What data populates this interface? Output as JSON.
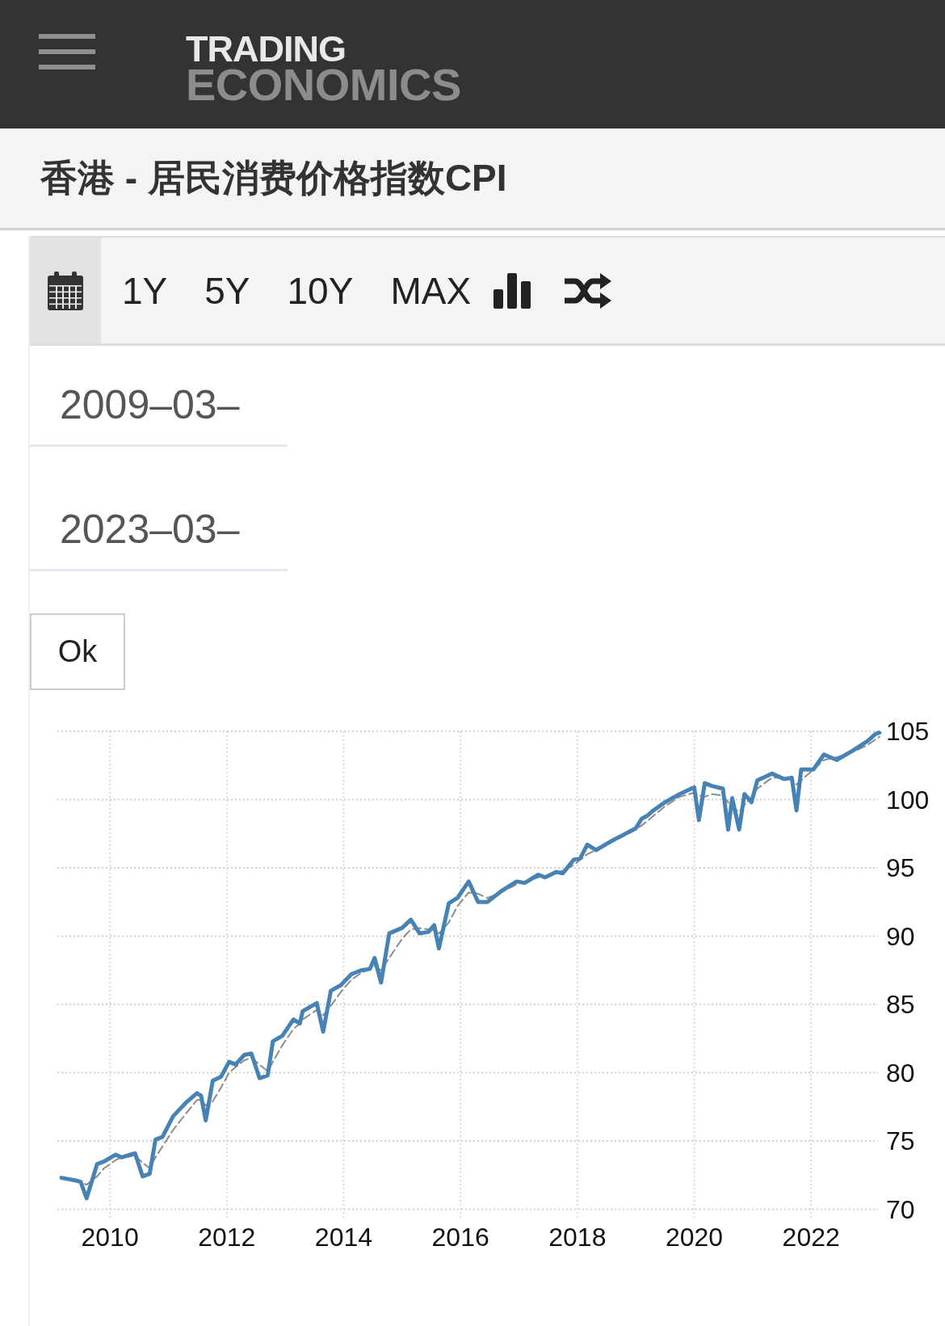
{
  "header": {
    "logo": {
      "line_1": "TRADING",
      "line_2": "ECONOMICS"
    }
  },
  "title": "香港 - 居民消费价格指数CPI",
  "toolbar": {
    "calendar_selected": true,
    "ranges": [
      {
        "label": "1Y",
        "selected": false
      },
      {
        "label": "5Y",
        "selected": false
      },
      {
        "label": "10Y",
        "selected": false
      },
      {
        "label": "MAX",
        "selected": false
      }
    ]
  },
  "date_range": {
    "from": {
      "value": "2009–03–"
    },
    "to": {
      "value": "2023–03–"
    },
    "ok_button": "Ok"
  },
  "chart": {
    "chart_data": {
      "type": "line",
      "grid": true,
      "x": [
        2009.17,
        2009.42,
        2009.5,
        2009.6,
        2009.78,
        2009.9,
        2010.1,
        2010.2,
        2010.43,
        2010.56,
        2010.68,
        2010.78,
        2010.9,
        2011.08,
        2011.3,
        2011.49,
        2011.56,
        2011.64,
        2011.76,
        2011.9,
        2012.04,
        2012.15,
        2012.3,
        2012.42,
        2012.56,
        2012.7,
        2012.79,
        2012.95,
        2013.14,
        2013.25,
        2013.3,
        2013.54,
        2013.65,
        2013.78,
        2013.95,
        2014.13,
        2014.3,
        2014.45,
        2014.53,
        2014.64,
        2014.78,
        2015.0,
        2015.15,
        2015.3,
        2015.45,
        2015.55,
        2015.63,
        2015.8,
        2015.95,
        2016.14,
        2016.3,
        2016.46,
        2016.7,
        2016.96,
        2017.1,
        2017.33,
        2017.45,
        2017.64,
        2017.75,
        2017.94,
        2018.05,
        2018.17,
        2018.32,
        2018.6,
        2019.0,
        2019.1,
        2019.19,
        2019.3,
        2019.5,
        2019.75,
        2020.0,
        2020.08,
        2020.18,
        2020.3,
        2020.49,
        2020.58,
        2020.65,
        2020.77,
        2020.86,
        2020.98,
        2021.08,
        2021.33,
        2021.54,
        2021.67,
        2021.75,
        2021.83,
        2022.04,
        2022.22,
        2022.44,
        2022.72,
        2022.97,
        2023.1,
        2023.17
      ],
      "series": [
        {
          "color": "#4682b4",
          "line_style": "solid",
          "values": [
            72.3,
            72.1,
            72.0,
            70.8,
            73.3,
            73.5,
            74.0,
            73.8,
            74.1,
            72.4,
            72.6,
            75.1,
            75.3,
            76.8,
            77.8,
            78.5,
            78.3,
            76.5,
            79.4,
            79.7,
            80.8,
            80.6,
            81.3,
            81.4,
            79.6,
            79.8,
            82.3,
            82.7,
            83.9,
            83.6,
            84.5,
            85.1,
            83.0,
            86.0,
            86.4,
            87.2,
            87.5,
            87.6,
            88.4,
            86.6,
            90.2,
            90.6,
            91.2,
            90.2,
            90.3,
            90.8,
            89.1,
            92.4,
            92.8,
            94.0,
            92.5,
            92.5,
            93.3,
            94.0,
            93.9,
            94.5,
            94.3,
            94.7,
            94.6,
            95.6,
            95.7,
            96.7,
            96.3,
            97.0,
            97.9,
            98.6,
            98.8,
            99.2,
            99.8,
            100.4,
            100.9,
            98.5,
            101.2,
            101.0,
            100.8,
            97.8,
            100.1,
            97.8,
            100.4,
            99.8,
            101.4,
            101.9,
            101.5,
            101.6,
            99.2,
            102.2,
            102.2,
            103.3,
            102.9,
            103.6,
            104.3,
            104.8,
            104.9
          ]
        },
        {
          "color": "#8c8c8c",
          "line_style": "dashed",
          "values": [
            72.3,
            72.1,
            72.0,
            71.8,
            72.4,
            73.0,
            73.6,
            73.8,
            73.9,
            73.4,
            73.0,
            73.8,
            74.6,
            75.8,
            77.0,
            78.0,
            78.0,
            77.6,
            77.9,
            78.9,
            80.0,
            80.4,
            80.9,
            81.1,
            80.6,
            80.1,
            80.8,
            82.0,
            83.2,
            83.6,
            83.9,
            84.6,
            84.2,
            84.9,
            85.9,
            86.8,
            87.3,
            87.6,
            87.8,
            87.5,
            88.4,
            89.8,
            90.5,
            90.6,
            90.5,
            90.4,
            90.2,
            91.0,
            92.2,
            93.2,
            93.1,
            92.8,
            93.2,
            93.8,
            94.0,
            94.3,
            94.4,
            94.6,
            94.8,
            95.2,
            95.6,
            96.0,
            96.3,
            96.9,
            97.8,
            98.1,
            98.4,
            98.8,
            99.5,
            100.2,
            100.5,
            100.3,
            100.2,
            100.4,
            100.3,
            99.8,
            99.4,
            99.1,
            99.6,
            100.2,
            100.8,
            101.6,
            101.6,
            101.5,
            101.1,
            101.4,
            102.2,
            102.9,
            103.1,
            103.5,
            104.0,
            104.4,
            104.6
          ]
        }
      ],
      "xlim": [
        2009.1,
        2023.2
      ],
      "ylim": [
        70,
        105
      ],
      "xticks": [
        2010,
        2012,
        2014,
        2016,
        2018,
        2020,
        2022
      ],
      "yticks": [
        70,
        75,
        80,
        85,
        90,
        95,
        100,
        105
      ]
    }
  }
}
